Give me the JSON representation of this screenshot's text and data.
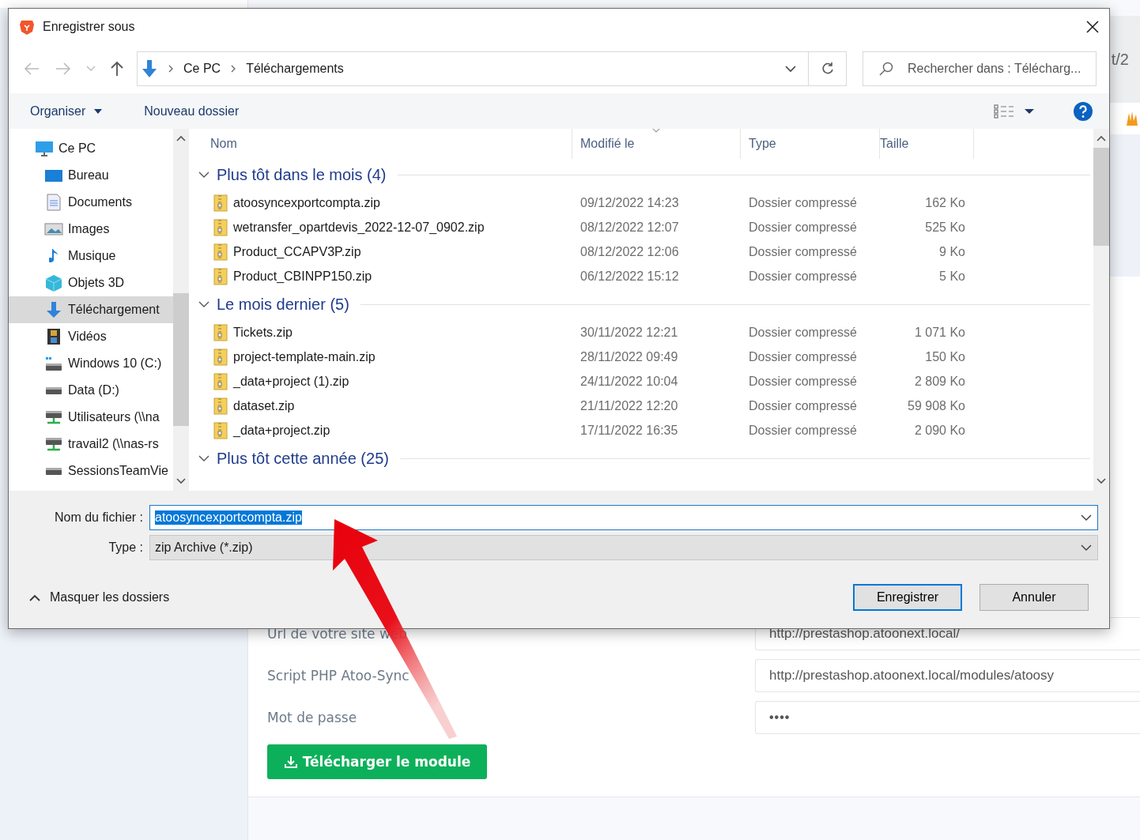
{
  "background_page": {
    "header_fragment": "t/2",
    "form": [
      {
        "label": "Url de votre site web",
        "value": "http://prestashop.atoonext.local/",
        "kind": "text"
      },
      {
        "label": "Script PHP Atoo-Sync",
        "value": "http://prestashop.atoonext.local/modules/atoosy",
        "kind": "text"
      },
      {
        "label": "Mot de passe",
        "value": "••••",
        "kind": "password"
      }
    ],
    "download_button": "Télécharger le module"
  },
  "dialog": {
    "title": "Enregistrer sous",
    "breadcrumb": [
      "Ce PC",
      "Téléchargements"
    ],
    "search": {
      "placeholder": "Rechercher dans : Télécharg..."
    },
    "toolbar": {
      "organize": "Organiser",
      "new_folder": "Nouveau dossier"
    },
    "sidebar": {
      "items": [
        {
          "label": "Ce PC",
          "kind": "pc",
          "selected": false,
          "children": [
            {
              "label": "Bureau",
              "kind": "desktop",
              "selected": false
            },
            {
              "label": "Documents",
              "kind": "documents",
              "selected": false
            },
            {
              "label": "Images",
              "kind": "images",
              "selected": false
            },
            {
              "label": "Musique",
              "kind": "music",
              "selected": false
            },
            {
              "label": "Objets 3D",
              "kind": "cube",
              "selected": false
            },
            {
              "label": "Téléchargement",
              "kind": "downloads",
              "selected": true
            },
            {
              "label": "Vidéos",
              "kind": "videos",
              "selected": false
            },
            {
              "label": "Windows 10 (C:)",
              "kind": "system-drive",
              "selected": false
            },
            {
              "label": "Data (D:)",
              "kind": "drive",
              "selected": false
            },
            {
              "label": "Utilisateurs (\\\\na",
              "kind": "network-drive",
              "selected": false
            },
            {
              "label": "travail2 (\\\\nas-rs",
              "kind": "network-drive",
              "selected": false
            },
            {
              "label": "SessionsTeamVie",
              "kind": "drive",
              "selected": false
            }
          ]
        }
      ]
    },
    "columns": [
      {
        "label": "Nom",
        "sorted": false
      },
      {
        "label": "Modifié le",
        "sorted": true
      },
      {
        "label": "Type",
        "sorted": false
      },
      {
        "label": "Taille",
        "sorted": false
      }
    ],
    "groups": [
      {
        "title": "Plus tôt dans le mois (4)",
        "expanded": true,
        "files": [
          {
            "name": "atoosyncexportcompta.zip",
            "modified": "09/12/2022 14:23",
            "type": "Dossier compressé",
            "size": "162 Ko"
          },
          {
            "name": "wetransfer_opartdevis_2022-12-07_0902.zip",
            "modified": "08/12/2022 12:07",
            "type": "Dossier compressé",
            "size": "525 Ko"
          },
          {
            "name": "Product_CCAPV3P.zip",
            "modified": "08/12/2022 12:06",
            "type": "Dossier compressé",
            "size": "9 Ko"
          },
          {
            "name": "Product_CBINPP150.zip",
            "modified": "06/12/2022 15:12",
            "type": "Dossier compressé",
            "size": "5 Ko"
          }
        ]
      },
      {
        "title": "Le mois dernier (5)",
        "expanded": true,
        "files": [
          {
            "name": "Tickets.zip",
            "modified": "30/11/2022 12:21",
            "type": "Dossier compressé",
            "size": "1 071 Ko"
          },
          {
            "name": "project-template-main.zip",
            "modified": "28/11/2022 09:49",
            "type": "Dossier compressé",
            "size": "150 Ko"
          },
          {
            "name": "_data+project (1).zip",
            "modified": "24/11/2022 10:04",
            "type": "Dossier compressé",
            "size": "2 809 Ko"
          },
          {
            "name": "dataset.zip",
            "modified": "21/11/2022 12:20",
            "type": "Dossier compressé",
            "size": "59 908 Ko"
          },
          {
            "name": "_data+project.zip",
            "modified": "17/11/2022 16:35",
            "type": "Dossier compressé",
            "size": "2 090 Ko"
          }
        ]
      },
      {
        "title": "Plus tôt cette année (25)",
        "expanded": true
      }
    ],
    "filename": {
      "label": "Nom du fichier :",
      "value": "atoosyncexportcompta.zip",
      "text_selected": true
    },
    "filetype": {
      "label": "Type :",
      "value": "zip Archive (*.zip)"
    },
    "hide_folders": "Masquer les dossiers",
    "buttons": [
      {
        "label": "Enregistrer",
        "default": true
      },
      {
        "label": "Annuler",
        "default": false
      }
    ]
  }
}
